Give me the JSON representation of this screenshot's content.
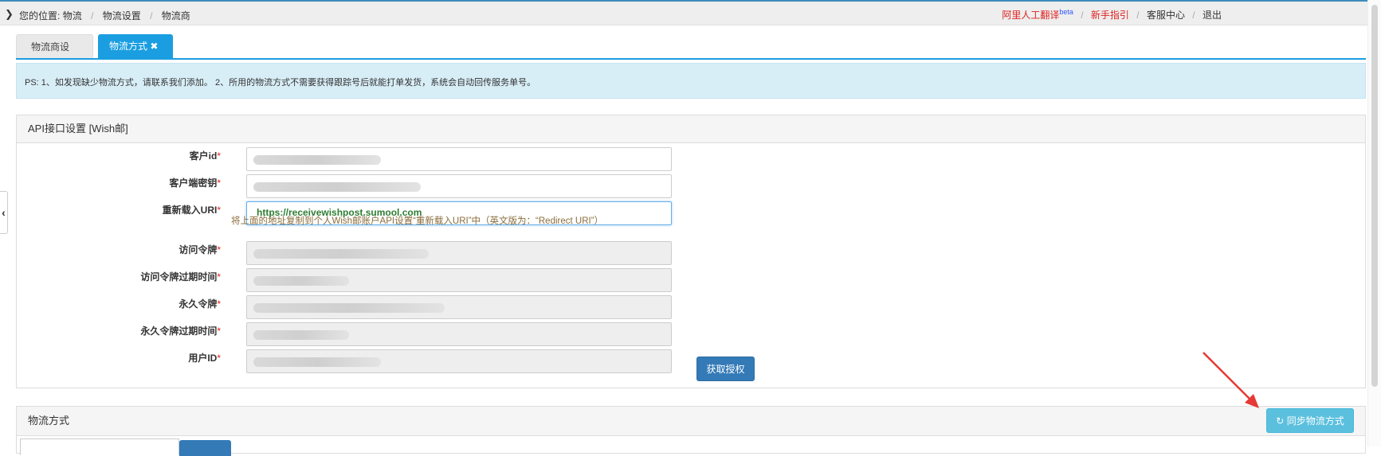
{
  "header": {
    "breadcrumb_prefix": "您的位置:",
    "breadcrumb": [
      "物流",
      "物流设置",
      "物流商"
    ],
    "links": {
      "translate": "阿里人工翻译",
      "translate_badge": "beta",
      "guide": "新手指引",
      "service": "客服中心",
      "logout": "退出"
    }
  },
  "tabs": [
    {
      "label": "物流商设置"
    },
    {
      "label": "物流方式 ✖"
    }
  ],
  "notice": "PS: 1、如发现缺少物流方式，请联系我们添加。 2、所用的物流方式不需要获得跟踪号后就能打单发货，系统会自动回传服务单号。",
  "api_panel": {
    "title": "API接口设置  [Wish邮]",
    "fields": [
      {
        "label": "客户id",
        "value": ""
      },
      {
        "label": "客户端密钥",
        "value": ""
      },
      {
        "label": "重新载入URI",
        "value": "https://receivewishpost.sumool.com"
      },
      {
        "label": "访问令牌",
        "value": ""
      },
      {
        "label": "访问令牌过期时间",
        "value": ""
      },
      {
        "label": "永久令牌",
        "value": ""
      },
      {
        "label": "永久令牌过期时间",
        "value": ""
      },
      {
        "label": "用户ID",
        "value": ""
      }
    ],
    "uri_hint": "将上面的地址复制到个人Wish邮账户API设置“重新载入URI”中（英文版为：“Redirect URI”）",
    "auth_button": "获取授权"
  },
  "shipping_panel": {
    "title": "物流方式",
    "sync_button": "同步物流方式"
  },
  "colors": {
    "primary": "#337ab7",
    "tab_active": "#1a9ee1",
    "info": "#5bc0de",
    "required": "#e02020",
    "annotation_arrow": "#e53935"
  }
}
